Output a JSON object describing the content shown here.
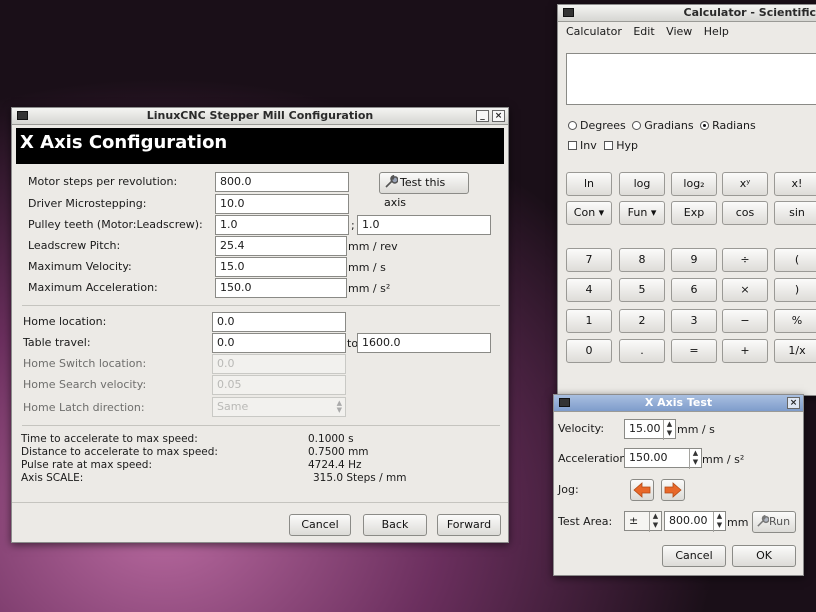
{
  "main_window": {
    "title": "LinuxCNC Stepper Mill Configuration",
    "minimize": "_",
    "close": "×",
    "header": "X Axis Configuration",
    "motor_steps": {
      "label": "Motor steps per revolution:",
      "value": "800.0"
    },
    "test_axis_button": "Test this axis",
    "driver_microstepping": {
      "label": "Driver Microstepping:",
      "value": "10.0"
    },
    "pulley_teeth": {
      "label": "Pulley teeth (Motor:Leadscrew):",
      "value_motor": "1.0",
      "separator": ";",
      "value_leadscrew": "1.0"
    },
    "leadscrew_pitch": {
      "label": "Leadscrew Pitch:",
      "value": "25.4",
      "unit": "mm / rev"
    },
    "max_velocity": {
      "label": "Maximum Velocity:",
      "value": "15.0",
      "unit": "mm / s"
    },
    "max_acceleration": {
      "label": "Maximum Acceleration:",
      "value": "150.0",
      "unit": "mm / s²"
    },
    "home_location": {
      "label": "Home location:",
      "value": "0.0"
    },
    "table_travel": {
      "label": "Table travel:",
      "from": "0.0",
      "to_label": "to",
      "to": "1600.0"
    },
    "home_switch_location": {
      "label": "Home Switch location:",
      "value": "0.0"
    },
    "home_search_velocity": {
      "label": "Home Search velocity:",
      "value": "0.05"
    },
    "home_latch_direction": {
      "label": "Home Latch direction:",
      "value": "Same"
    },
    "stats": {
      "accel_time_label": "Time to accelerate to max speed:",
      "accel_time_value": "0.1000 s",
      "accel_distance_label": "Distance to accelerate to max speed:",
      "accel_distance_value": "0.7500 mm",
      "pulse_rate_label": "Pulse rate at max speed:",
      "pulse_rate_value": "4724.4 Hz",
      "axis_scale_label": "Axis SCALE:",
      "axis_scale_value": "315.0 Steps / mm"
    },
    "cancel_button": "Cancel",
    "back_button": "Back",
    "forward_button": "Forward"
  },
  "calculator": {
    "title": "Calculator - Scientific",
    "menu": [
      "Calculator",
      "Edit",
      "View",
      "Help"
    ],
    "display_value": "",
    "angle_modes": [
      "Degrees",
      "Gradians",
      "Radians"
    ],
    "selected_angle_mode": "Radians",
    "inv_label": "Inv",
    "hyp_label": "Hyp",
    "func_row1": [
      "ln",
      "log",
      "log₂",
      "xʸ",
      "x!"
    ],
    "func_row2": [
      "Con ▾",
      "Fun ▾",
      "Exp",
      "cos",
      "sin"
    ],
    "keypad": [
      [
        "7",
        "8",
        "9",
        "÷",
        "("
      ],
      [
        "4",
        "5",
        "6",
        "×",
        ")"
      ],
      [
        "1",
        "2",
        "3",
        "−",
        "%"
      ],
      [
        "0",
        ".",
        "=",
        "+",
        "1/x"
      ]
    ]
  },
  "axis_test": {
    "title": "X Axis Test",
    "velocity": {
      "label": "Velocity:",
      "value": "15.00",
      "unit": "mm / s"
    },
    "acceleration": {
      "label": "Acceleration:",
      "value": "150.00",
      "unit": "mm / s²"
    },
    "jog_label": "Jog:",
    "test_area": {
      "label": "Test Area:",
      "sign": "±",
      "value": "800.00",
      "unit": "mm"
    },
    "run_button": "Run",
    "cancel_button": "Cancel",
    "ok_button": "OK"
  },
  "colors": {
    "jog_arrow": "#e8682a",
    "titlebar_active": "#7e9ccb"
  }
}
